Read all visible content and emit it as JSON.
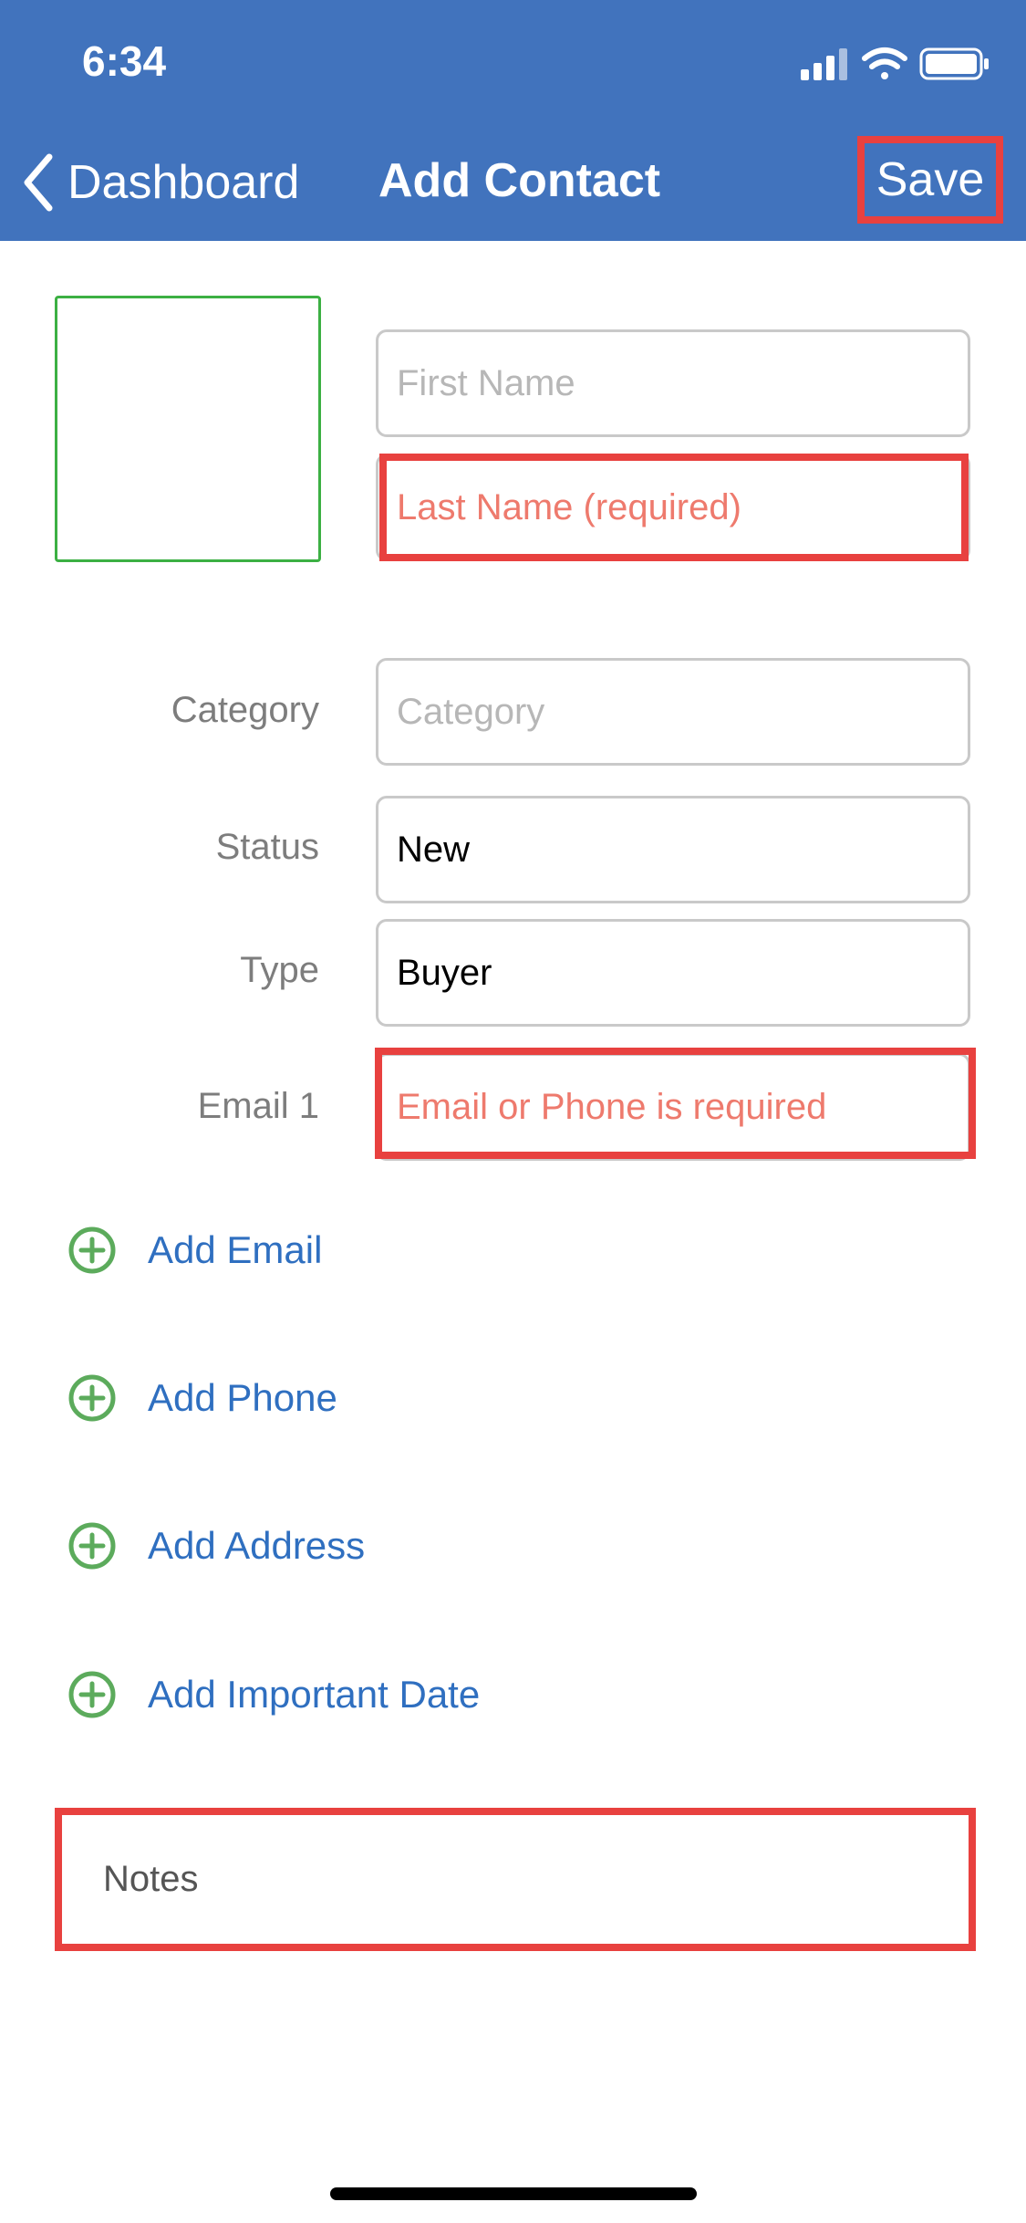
{
  "status_bar": {
    "time": "6:34"
  },
  "nav": {
    "back_label": "Dashboard",
    "title": "Add Contact",
    "save_label": "Save"
  },
  "form": {
    "first_name": {
      "placeholder": "First Name",
      "value": ""
    },
    "last_name": {
      "placeholder": "Last Name (required)",
      "value": ""
    },
    "category": {
      "label": "Category",
      "placeholder": "Category",
      "value": ""
    },
    "status": {
      "label": "Status",
      "value": "New"
    },
    "type": {
      "label": "Type",
      "value": "Buyer"
    },
    "email1": {
      "label": "Email 1",
      "placeholder": "Email or Phone is required",
      "value": ""
    }
  },
  "add_actions": [
    {
      "label": "Add Email"
    },
    {
      "label": "Add Phone"
    },
    {
      "label": "Add Address"
    },
    {
      "label": "Add Important Date"
    }
  ],
  "notes": {
    "placeholder": "Notes"
  },
  "colors": {
    "header": "#4173bd",
    "highlight": "#e8413f",
    "link": "#2f6fc0",
    "add_icon": "#5cab5c",
    "error_text": "#ee7a6d",
    "photo_border": "#3cb043"
  }
}
